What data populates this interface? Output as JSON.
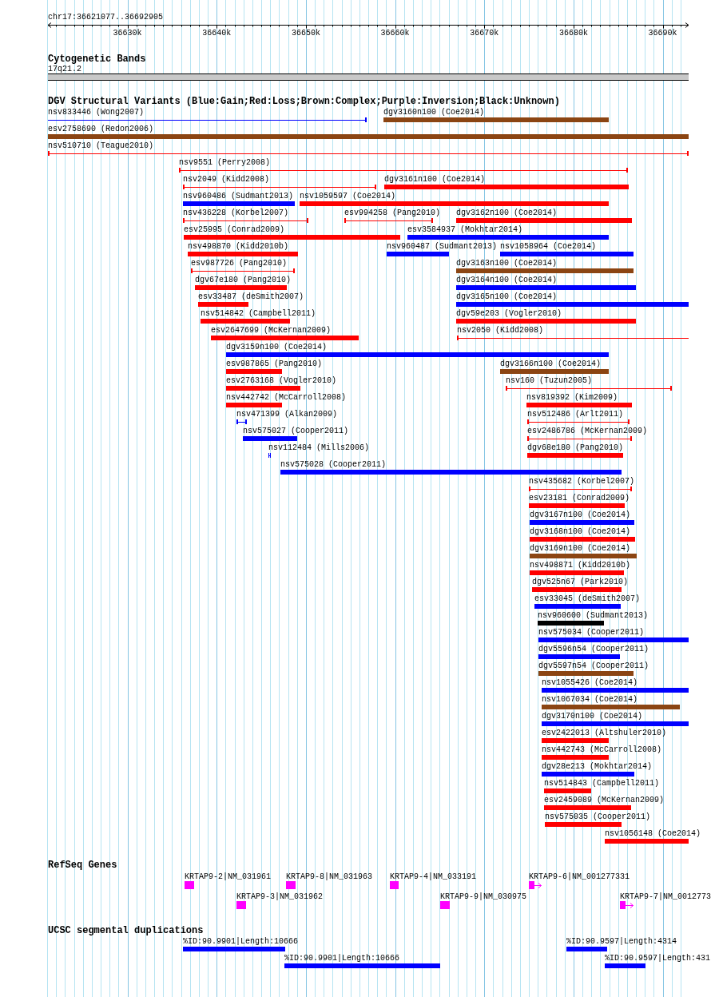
{
  "ruler": {
    "range": "chr17:36621077..36692905",
    "ticks": [
      "36630k",
      "36640k",
      "36650k",
      "36660k",
      "36670k",
      "36680k",
      "36690k"
    ]
  },
  "cytogenetic_bands": {
    "title": "Cytogenetic Bands",
    "band": "17q21.2"
  },
  "dgv_track": {
    "title": "DGV Structural Variants (Blue:Gain;Red:Loss;Brown:Complex;Purple:Inversion;Black:Unknown)",
    "rows": [
      [
        {
          "label": "nsv833446 (Wong2007)",
          "kind": "line",
          "color": "#0000ff"
        },
        {
          "label": "dgv3160n100 (Coe2014)",
          "kind": "bar",
          "color": "#8b4513"
        }
      ],
      [
        {
          "label": "esv2758690 (Redon2006)",
          "kind": "bar",
          "color": "#8b4513"
        }
      ],
      [
        {
          "label": "nsv510710 (Teague2010)",
          "kind": "line",
          "color": "#ff0000"
        }
      ],
      [
        {
          "label": "nsv9551 (Perry2008)",
          "kind": "line",
          "color": "#ff0000"
        }
      ],
      [
        {
          "label": "nsv2049 (Kidd2008)",
          "kind": "line",
          "color": "#ff0000"
        },
        {
          "label": "dgv3161n100 (Coe2014)",
          "kind": "bar",
          "color": "#ff0000"
        }
      ],
      [
        {
          "label": "nsv960486 (Sudmant2013)",
          "kind": "bar",
          "color": "#0000ff"
        },
        {
          "label": "nsv1059597 (Coe2014)",
          "kind": "bar",
          "color": "#ff0000"
        }
      ],
      [
        {
          "label": "nsv436228 (Korbel2007)",
          "kind": "line",
          "color": "#ff0000"
        },
        {
          "label": "esv994258 (Pang2010)",
          "kind": "line",
          "color": "#ff0000"
        },
        {
          "label": "dgv3162n100 (Coe2014)",
          "kind": "bar",
          "color": "#ff0000"
        }
      ],
      [
        {
          "label": "esv25995 (Conrad2009)",
          "kind": "bar",
          "color": "#ff0000"
        },
        {
          "label": "esv3584937 (Mokhtar2014)",
          "kind": "bar",
          "color": "#0000ff"
        }
      ],
      [
        {
          "label": "nsv498870 (Kidd2010b)",
          "kind": "bar",
          "color": "#ff0000"
        },
        {
          "label": "nsv960487 (Sudmant2013)",
          "kind": "bar",
          "color": "#0000ff"
        },
        {
          "label": "nsv1058964 (Coe2014)",
          "kind": "bar",
          "color": "#0000ff"
        }
      ],
      [
        {
          "label": "esv987726 (Pang2010)",
          "kind": "line",
          "color": "#ff0000"
        },
        {
          "label": "dgv3163n100 (Coe2014)",
          "kind": "bar",
          "color": "#8b4513"
        }
      ],
      [
        {
          "label": "dgv67e180 (Pang2010)",
          "kind": "bar",
          "color": "#ff0000"
        },
        {
          "label": "dgv3164n100 (Coe2014)",
          "kind": "bar",
          "color": "#0000ff"
        }
      ],
      [
        {
          "label": "esv33487 (deSmith2007)",
          "kind": "bar",
          "color": "#ff0000"
        },
        {
          "label": "dgv3165n100 (Coe2014)",
          "kind": "bar",
          "color": "#0000ff"
        }
      ],
      [
        {
          "label": "nsv514842 (Campbell2011)",
          "kind": "bar",
          "color": "#ff0000"
        },
        {
          "label": "dgv59e203 (Vogler2010)",
          "kind": "bar",
          "color": "#ff0000"
        }
      ],
      [
        {
          "label": "esv2647699 (McKernan2009)",
          "kind": "bar",
          "color": "#ff0000"
        },
        {
          "label": "nsv2050 (Kidd2008)",
          "kind": "line",
          "color": "#ff0000"
        }
      ],
      [
        {
          "label": "dgv3159n100 (Coe2014)",
          "kind": "bar",
          "color": "#0000ff"
        }
      ],
      [
        {
          "label": "esv987865 (Pang2010)",
          "kind": "bar",
          "color": "#ff0000"
        },
        {
          "label": "dgv3166n100 (Coe2014)",
          "kind": "bar",
          "color": "#8b4513"
        }
      ],
      [
        {
          "label": "esv2763168 (Vogler2010)",
          "kind": "bar",
          "color": "#ff0000"
        },
        {
          "label": "nsv160 (Tuzun2005)",
          "kind": "line",
          "color": "#ff0000"
        }
      ],
      [
        {
          "label": "nsv442742 (McCarroll2008)",
          "kind": "bar",
          "color": "#ff0000"
        },
        {
          "label": "nsv819392 (Kim2009)",
          "kind": "bar",
          "color": "#ff0000"
        }
      ],
      [
        {
          "label": "nsv471399 (Alkan2009)",
          "kind": "line",
          "color": "#0000ff"
        },
        {
          "label": "nsv512486 (Arlt2011)",
          "kind": "line",
          "color": "#ff0000"
        }
      ],
      [
        {
          "label": "nsv575027 (Cooper2011)",
          "kind": "bar",
          "color": "#0000ff"
        },
        {
          "label": "esv2486786 (McKernan2009)",
          "kind": "line",
          "color": "#ff0000"
        }
      ],
      [
        {
          "label": "nsv112484 (Mills2006)",
          "kind": "line",
          "color": "#0000ff"
        },
        {
          "label": "dgv68e180 (Pang2010)",
          "kind": "bar",
          "color": "#ff0000"
        }
      ],
      [
        {
          "label": "nsv575028 (Cooper2011)",
          "kind": "bar",
          "color": "#0000ff"
        }
      ],
      [
        {
          "label": "nsv435682 (Korbel2007)",
          "kind": "line",
          "color": "#ff0000"
        }
      ],
      [
        {
          "label": "esv23181 (Conrad2009)",
          "kind": "bar",
          "color": "#ff0000"
        }
      ],
      [
        {
          "label": "dgv3167n100 (Coe2014)",
          "kind": "bar",
          "color": "#0000ff"
        }
      ],
      [
        {
          "label": "dgv3168n100 (Coe2014)",
          "kind": "bar",
          "color": "#ff0000"
        }
      ],
      [
        {
          "label": "dgv3169n100 (Coe2014)",
          "kind": "bar",
          "color": "#8b4513"
        }
      ],
      [
        {
          "label": "nsv498871 (Kidd2010b)",
          "kind": "bar",
          "color": "#ff0000"
        }
      ],
      [
        {
          "label": "dgv525n67 (Park2010)",
          "kind": "bar",
          "color": "#ff0000"
        }
      ],
      [
        {
          "label": "esv33045 (deSmith2007)",
          "kind": "bar",
          "color": "#0000ff"
        }
      ],
      [
        {
          "label": "nsv960600 (Sudmant2013)",
          "kind": "bar",
          "color": "#000000"
        }
      ],
      [
        {
          "label": "nsv575034 (Cooper2011)",
          "kind": "bar",
          "color": "#0000ff"
        }
      ],
      [
        {
          "label": "dgv5596n54 (Cooper2011)",
          "kind": "bar",
          "color": "#0000ff"
        }
      ],
      [
        {
          "label": "dgv5597n54 (Cooper2011)",
          "kind": "bar",
          "color": "#8b4513"
        }
      ],
      [
        {
          "label": "nsv1055426 (Coe2014)",
          "kind": "bar",
          "color": "#0000ff"
        }
      ],
      [
        {
          "label": "nsv1067034 (Coe2014)",
          "kind": "bar",
          "color": "#8b4513"
        }
      ],
      [
        {
          "label": "dgv3170n100 (Coe2014)",
          "kind": "bar",
          "color": "#0000ff"
        }
      ],
      [
        {
          "label": "esv2422013 (Altshuler2010)",
          "kind": "bar",
          "color": "#ff0000"
        }
      ],
      [
        {
          "label": "nsv442743 (McCarroll2008)",
          "kind": "bar",
          "color": "#ff0000"
        }
      ],
      [
        {
          "label": "dgv28e213 (Mokhtar2014)",
          "kind": "bar",
          "color": "#0000ff"
        }
      ],
      [
        {
          "label": "nsv514843 (Campbell2011)",
          "kind": "bar",
          "color": "#ff0000"
        }
      ],
      [
        {
          "label": "esv2459089 (McKernan2009)",
          "kind": "bar",
          "color": "#ff0000"
        }
      ],
      [
        {
          "label": "nsv575035 (Cooper2011)",
          "kind": "bar",
          "color": "#ff0000"
        }
      ],
      [
        {
          "label": "nsv1056148 (Coe2014)",
          "kind": "bar",
          "color": "#ff0000"
        }
      ]
    ]
  },
  "refseq_genes": {
    "title": "RefSeq Genes",
    "rows": [
      [
        {
          "label": "KRTAP9-2|NM_031961",
          "kind": "block"
        },
        {
          "label": "KRTAP9-8|NM_031963",
          "kind": "block"
        },
        {
          "label": "KRTAP9-4|NM_033191",
          "kind": "block"
        },
        {
          "label": "KRTAP9-6|NM_001277331",
          "kind": "arrow"
        }
      ],
      [
        {
          "label": "KRTAP9-3|NM_031962",
          "kind": "block"
        },
        {
          "label": "KRTAP9-9|NM_030975",
          "kind": "block"
        },
        {
          "label": "KRTAP9-7|NM_0012773",
          "kind": "arrow"
        }
      ]
    ]
  },
  "segmental_duplications": {
    "title": "UCSC segmental duplications",
    "rows": [
      [
        {
          "label": "%ID:90.9901|Length:10666"
        },
        {
          "label": "%ID:90.9597|Length:4314"
        }
      ],
      [
        {
          "label": "%ID:90.9901|Length:10666"
        },
        {
          "label": "%ID:90.9597|Length:431"
        }
      ]
    ]
  }
}
